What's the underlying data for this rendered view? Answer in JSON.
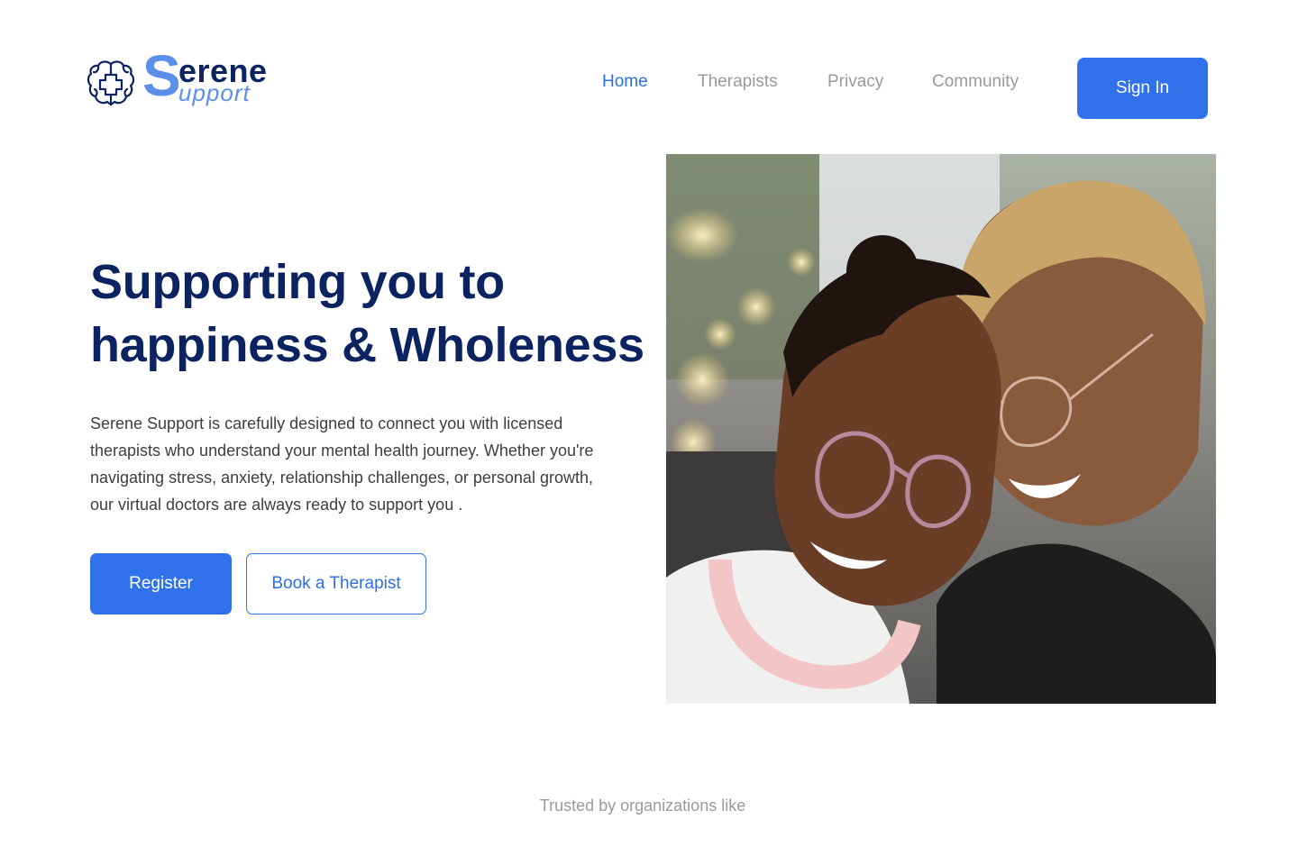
{
  "brand": {
    "logo_initial": "S",
    "logo_line1": "erene",
    "logo_line2": "upport",
    "primary_color": "#2f72ec",
    "navy_color": "#0b2360"
  },
  "nav": {
    "items": [
      {
        "label": "Home",
        "active": true
      },
      {
        "label": "Therapists",
        "active": false
      },
      {
        "label": "Privacy",
        "active": false
      },
      {
        "label": "Community",
        "active": false
      }
    ],
    "signin_label": "Sign In"
  },
  "hero": {
    "title_line1": "Supporting you to",
    "title_line2": "happiness & Wholeness",
    "description": "Serene Support is carefully designed to connect you with licensed therapists who understand your mental health journey. Whether you're navigating stress, anxiety, relationship challenges, or personal growth, our virtual doctors are always ready to support you .",
    "register_label": "Register",
    "book_label": "Book a Therapist"
  },
  "trusted": {
    "label": "Trusted by organizations like"
  }
}
